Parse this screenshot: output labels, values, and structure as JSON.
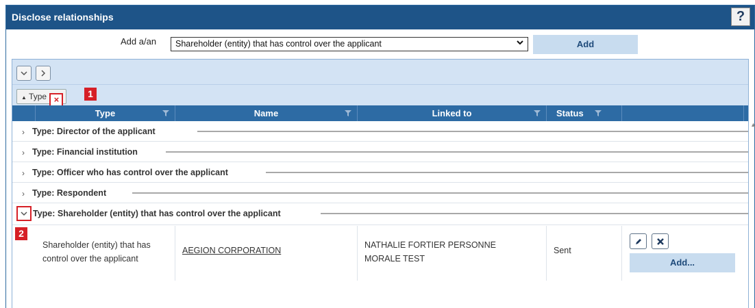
{
  "window": {
    "title": "Disclose relationships",
    "help_label": "?"
  },
  "add_row": {
    "label": "Add a/an",
    "selected_option": "Shareholder (entity) that has control over the applicant",
    "add_button": "Add"
  },
  "toolbar": {
    "expand_all": "⌄",
    "collapse_all": "›"
  },
  "grouping": {
    "chip_label": "Type",
    "remove_glyph": "×",
    "badge_1": "1",
    "badge_2": "2"
  },
  "columns": [
    "Type",
    "Name",
    "Linked to",
    "Status"
  ],
  "groups": [
    {
      "label": "Type: Director of the applicant",
      "expanded": false
    },
    {
      "label": "Type: Financial institution",
      "expanded": false
    },
    {
      "label": "Type: Officer who has control over the applicant",
      "expanded": false
    },
    {
      "label": "Type: Respondent",
      "expanded": false
    },
    {
      "label": "Type: Shareholder (entity) that has control over the applicant",
      "expanded": true
    }
  ],
  "record": {
    "type_line1": "Shareholder (entity) that has",
    "type_line2": "control over the applicant",
    "name": "AEGION CORPORATION",
    "linked_line1": "NATHALIE FORTIER PERSONNE",
    "linked_line2": "MORALE TEST",
    "status": "Sent",
    "add_label": "Add..."
  },
  "colors": {
    "title_bar": "#1e5488",
    "header": "#2d6ba4",
    "toolbar": "#d3e3f4",
    "button": "#c8dcef",
    "highlight": "#d61f26"
  },
  "icons": [
    "help-icon",
    "chevron-down-icon",
    "chevron-right-icon",
    "close-icon",
    "filter-icon",
    "edit-icon",
    "delete-icon"
  ]
}
